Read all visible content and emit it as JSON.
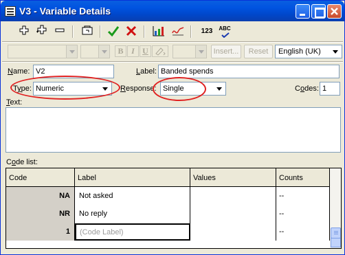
{
  "window": {
    "title": "V3 - Variable Details"
  },
  "icons": {
    "toolbar": [
      "add-plus-icon",
      "add-multi-icon",
      "minus-icon",
      "folder-icon",
      "checkmark-icon",
      "cross-icon",
      "chart-icon",
      "signature-icon",
      "numbers-icon",
      "spellcheck-icon"
    ],
    "titlebar": [
      "minimize-icon",
      "maximize-icon",
      "close-icon"
    ]
  },
  "toolbar2": {
    "bold": "B",
    "italic": "I",
    "underline": "U",
    "insert_label": "Insert...",
    "reset_label": "Reset",
    "language": "English (UK)"
  },
  "numbers_icon_text": "123",
  "spell_icon_text": "ABC",
  "form": {
    "name_label_u": "N",
    "name_label_rest": "ame:",
    "name_value": "V2",
    "label_label_u": "L",
    "label_label_rest": "abel:",
    "label_value": "Banded spends",
    "type_label_pre": "T",
    "type_label_u": "y",
    "type_label_rest": "pe:",
    "type_value": "Numeric",
    "response_label_u": "R",
    "response_label_rest": "esponse:",
    "response_value": "Single",
    "codes_label_pre": "C",
    "codes_label_u": "o",
    "codes_label_rest": "des:",
    "codes_value": "1",
    "text_label_u": "T",
    "text_label_rest": "ext:",
    "codelist_label_pre": "C",
    "codelist_label_u": "o",
    "codelist_label_rest": "de list:"
  },
  "table": {
    "headers": [
      "Code",
      "Label",
      "Values",
      "Counts"
    ],
    "rows": [
      {
        "code": "NA",
        "label": "Not asked",
        "values": "",
        "counts": "--"
      },
      {
        "code": "NR",
        "label": "No reply",
        "values": "",
        "counts": "--"
      },
      {
        "code": "1",
        "label": "(Code Label)",
        "values": "",
        "counts": "--"
      }
    ]
  },
  "annotation_color": "#e02020"
}
